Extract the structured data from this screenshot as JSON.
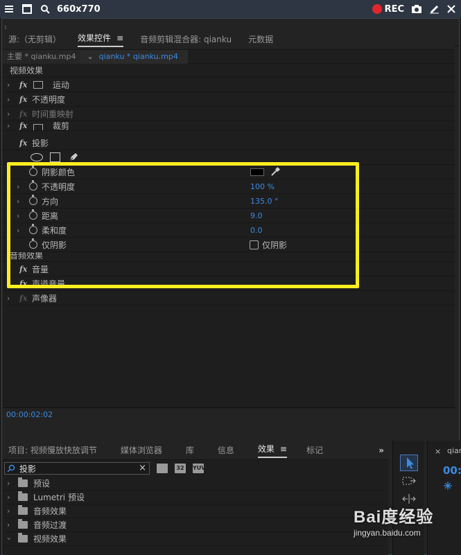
{
  "recorder": {
    "size_label": "660x770",
    "rec_label": "REC"
  },
  "effect_panel": {
    "tabs": [
      {
        "label": "源:（无剪辑）"
      },
      {
        "label": "效果控件"
      },
      {
        "label": "音频剪辑混合器: qianku"
      },
      {
        "label": "元数据"
      }
    ],
    "source_main": "主要 * qianku.mp4",
    "source_clip": "qianku * qianku.mp4",
    "video_header": "视频效果",
    "video_effects": [
      {
        "label": "运动"
      },
      {
        "label": "不透明度"
      },
      {
        "label": "时间重映射"
      },
      {
        "label": "裁剪"
      }
    ],
    "drop_shadow": {
      "label": "投影",
      "params": [
        {
          "label": "阴影颜色",
          "value": ""
        },
        {
          "label": "不透明度",
          "value": "100 %"
        },
        {
          "label": "方向",
          "value": "135.0 °"
        },
        {
          "label": "距离",
          "value": "9.0"
        },
        {
          "label": "柔和度",
          "value": "0.0"
        },
        {
          "label": "仅阴影",
          "value": "仅阴影"
        }
      ],
      "shadow_color": "#000000"
    },
    "audio_header": "音频效果",
    "audio_effects": [
      {
        "label": "音量"
      },
      {
        "label": "声道音量"
      },
      {
        "label": "声像器"
      }
    ],
    "timecode": "00:00:02:02",
    "highlight_color": "#ffee1f"
  },
  "project_panel": {
    "tabs": [
      {
        "label": "项目: 视频慢放快放调节"
      },
      {
        "label": "媒体浏览器"
      },
      {
        "label": "库"
      },
      {
        "label": "信息"
      },
      {
        "label": "效果"
      },
      {
        "label": "标记"
      }
    ],
    "more": "»",
    "search_value": "投影",
    "filter_buttons": [
      "",
      "32",
      "YUV"
    ],
    "folders": [
      {
        "label": "预设"
      },
      {
        "label": "Lumetri 预设"
      },
      {
        "label": "音频效果"
      },
      {
        "label": "音频过渡"
      },
      {
        "label": "视频效果"
      }
    ]
  },
  "right_panel": {
    "name": "qian",
    "timecode": "00:"
  },
  "watermark": {
    "brand": "Bai度经验",
    "url": "jingyan.baidu.com"
  },
  "colors": {
    "accent_blue": "#3c8ae0",
    "rec_red": "#e0262c"
  }
}
